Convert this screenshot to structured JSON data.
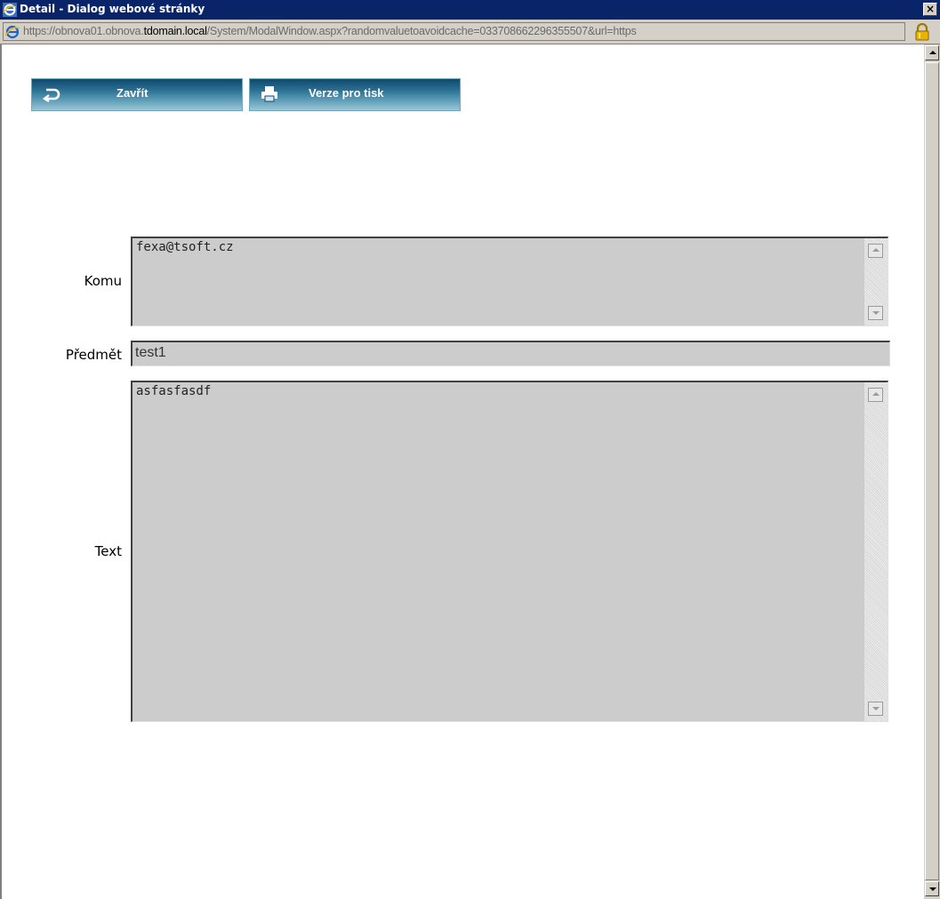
{
  "window": {
    "title": "Detail - Dialog webové stránky",
    "close_glyph": "×",
    "url_prefix": "https://obnova01.obnova.",
    "url_host": "tdomain.local",
    "url_suffix": "/System/ModalWindow.aspx?randomvaluetoavoidcache=033708662296355507&url=https",
    "app_icon": "ie-icon",
    "security_icon": "lock-icon"
  },
  "toolbar": {
    "close_label": "Zavřít",
    "close_icon": "return-arrow-icon",
    "print_label": "Verze pro tisk",
    "print_icon": "printer-icon"
  },
  "form": {
    "to": {
      "label": "Komu",
      "value": "fexa@tsoft.cz"
    },
    "subject": {
      "label": "Předmět",
      "value": "test1"
    },
    "text": {
      "label": "Text",
      "value": "asfasfasdf"
    }
  },
  "colors": {
    "title_bar": "#0a246a",
    "button_gradient_dark": "#0f4a6e",
    "button_gradient_light": "#9cc6d6",
    "field_background": "#cccccc"
  }
}
